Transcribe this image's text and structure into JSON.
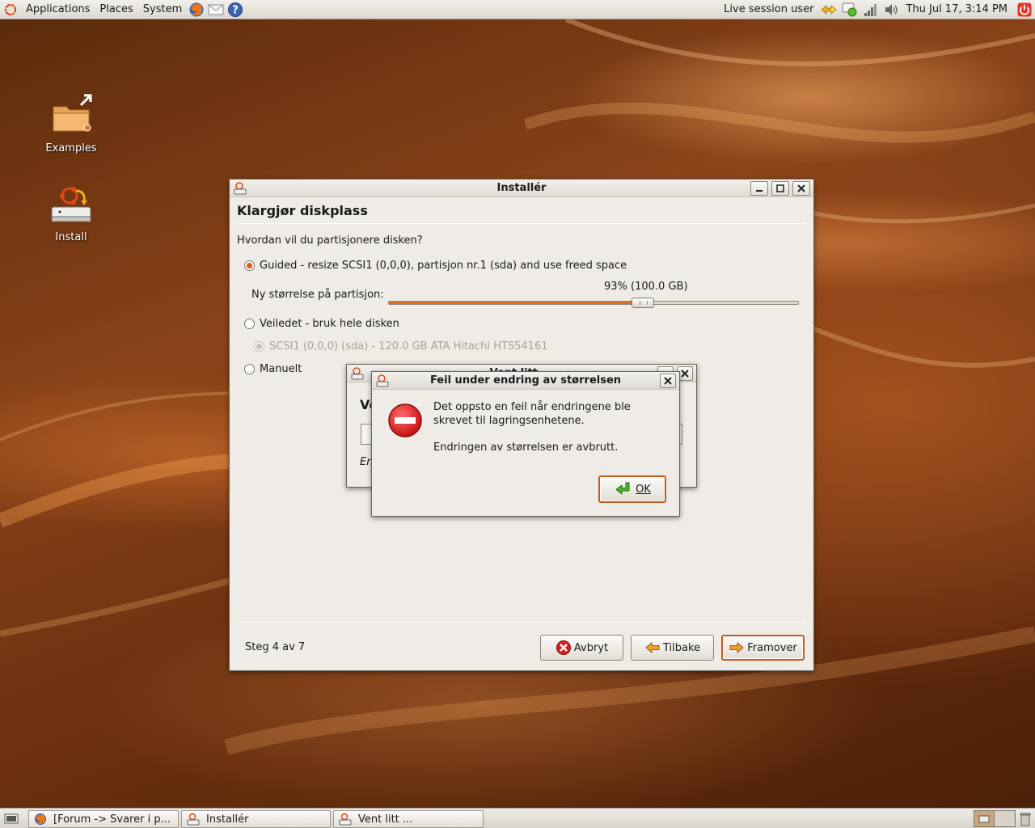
{
  "top_panel": {
    "menus": [
      "Applications",
      "Places",
      "System"
    ],
    "user": "Live session user",
    "clock": "Thu Jul 17,  3:14 PM"
  },
  "desktop_icons": [
    {
      "label": "Examples"
    },
    {
      "label": "Install"
    }
  ],
  "installer": {
    "title": "Installér",
    "heading": "Klargjør diskplass",
    "question": "Hvordan vil du partisjonere disken?",
    "option_guided_resize": "Guided - resize SCSI1 (0,0,0), partisjon nr.1 (sda) and use freed space",
    "slider_label": "Ny størrelse på partisjon:",
    "slider_value_text": "93% (100.0 GB)",
    "slider_fraction": 0.62,
    "option_whole_disk": "Veiledet - bruk hele disken",
    "disk_option": "SCSI1 (0,0,0) (sda) - 120.0 GB ATA Hitachi HTS54161",
    "option_manual": "Manuelt",
    "step": "Steg 4 av 7",
    "buttons": {
      "cancel": "Avbryt",
      "back": "Tilbake",
      "forward": "Framover"
    }
  },
  "wait_dialog": {
    "title": "Vent litt ...",
    "heading_fragment": "Ve",
    "status_fragment": "En"
  },
  "error_dialog": {
    "title": "Feil under endring av størrelsen",
    "message": "Det oppsto en feil når endringene ble skrevet til lagringsenhetene.",
    "detail": "Endringen av størrelsen er avbrutt.",
    "ok_label": "OK"
  },
  "taskbar": {
    "items": [
      "[Forum -> Svarer i p...",
      "Installér",
      "Vent litt ..."
    ]
  },
  "colors": {
    "accent": "#e07020",
    "error_red": "#d42020",
    "panel": "#e6e2dc"
  }
}
